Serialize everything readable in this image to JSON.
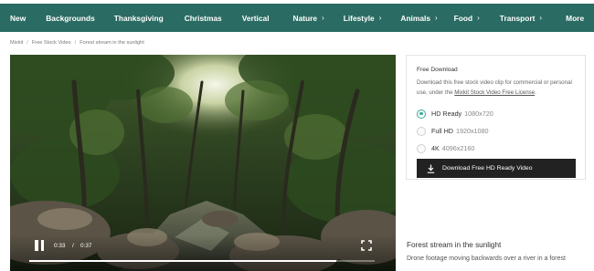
{
  "nav": {
    "items": [
      {
        "label": "New",
        "chevron": false
      },
      {
        "label": "Backgrounds",
        "chevron": false
      },
      {
        "label": "Thanksgiving",
        "chevron": false
      },
      {
        "label": "Christmas",
        "chevron": false
      },
      {
        "label": "Vertical",
        "chevron": false
      },
      {
        "label": "Nature",
        "chevron": true
      },
      {
        "label": "Lifestyle",
        "chevron": true
      },
      {
        "label": "Animals",
        "chevron": true
      },
      {
        "label": "Food",
        "chevron": true
      },
      {
        "label": "Transport",
        "chevron": true
      },
      {
        "label": "More",
        "chevron": false
      }
    ],
    "chevron_glyph": "›",
    "bg_color": "#2a6b63"
  },
  "breadcrumb": {
    "items": [
      "Mixkit",
      "Free Stock Video",
      "Forest stream in the sunlight"
    ],
    "separator": "/"
  },
  "player": {
    "current_time": "0:33",
    "separator": "/",
    "duration": "0:37",
    "progress_fraction": 0.89
  },
  "download": {
    "title": "Free Download",
    "desc_before": "Download this free stock video clip for commercial or personal use, under the ",
    "license_link": "Mixkit Stock Video Free License",
    "desc_after": ".",
    "options": [
      {
        "label": "HD Ready",
        "res": "1080x720",
        "selected": true
      },
      {
        "label": "Full HD",
        "res": "1920x1080",
        "selected": false
      },
      {
        "label": "4K",
        "res": "4096x2160",
        "selected": false
      }
    ],
    "button_label": "Download Free HD Ready Video",
    "accent_color": "#35a99a"
  },
  "video": {
    "title": "Forest stream in the sunlight",
    "description": "Drone footage moving backwards over a river in a forest"
  }
}
